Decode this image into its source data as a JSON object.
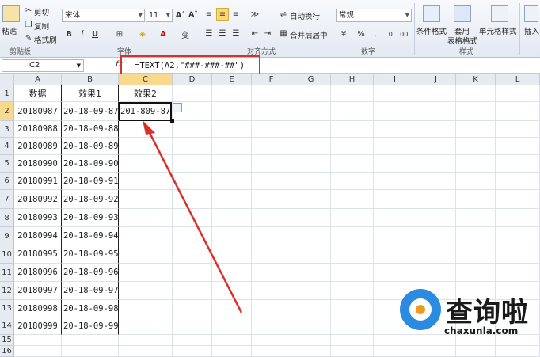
{
  "ribbon": {
    "clipboard": {
      "paste": "粘贴",
      "cut": "剪切",
      "copy": "复制",
      "format_painter": "格式刷",
      "group": "剪贴板"
    },
    "font": {
      "font_name": "宋体",
      "font_size": "11",
      "group": "字体",
      "bold": "B",
      "italic": "I",
      "underline": "U"
    },
    "alignment": {
      "wrap": "自动换行",
      "merge": "合并后居中",
      "group": "对齐方式"
    },
    "number": {
      "format": "常规",
      "percent": "%",
      "comma": ",",
      "group": "数字"
    },
    "styles": {
      "conditional": "条件格式",
      "table": "套用",
      "table2": "表格格式",
      "cell_styles": "单元格样式",
      "group": "样式"
    },
    "cells": {
      "insert": "插入"
    }
  },
  "formula_bar": {
    "name_box": "C2",
    "fx": "fx",
    "formula": "=TEXT(A2,\"###-###-##\")"
  },
  "columns": [
    "A",
    "B",
    "C",
    "D",
    "E",
    "F",
    "G",
    "H",
    "I",
    "J",
    "K",
    "L"
  ],
  "rows": [
    "1",
    "2",
    "3",
    "4",
    "5",
    "6",
    "7",
    "8",
    "9",
    "10",
    "11",
    "12",
    "13",
    "14",
    "15",
    "16"
  ],
  "headers": {
    "a": "数据",
    "b": "效果1",
    "c": "效果2"
  },
  "data": [
    {
      "a": "20180987",
      "b": "20-18-09-87",
      "c": "201-809-87"
    },
    {
      "a": "20180988",
      "b": "20-18-09-88"
    },
    {
      "a": "20180989",
      "b": "20-18-09-89"
    },
    {
      "a": "20180990",
      "b": "20-18-09-90"
    },
    {
      "a": "20180991",
      "b": "20-18-09-91"
    },
    {
      "a": "20180992",
      "b": "20-18-09-92"
    },
    {
      "a": "20180993",
      "b": "20-18-09-93"
    },
    {
      "a": "20180994",
      "b": "20-18-09-94"
    },
    {
      "a": "20180995",
      "b": "20-18-09-95"
    },
    {
      "a": "20180996",
      "b": "20-18-09-96"
    },
    {
      "a": "20180997",
      "b": "20-18-09-97"
    },
    {
      "a": "20180998",
      "b": "20-18-09-98"
    },
    {
      "a": "20180999",
      "b": "20-18-09-99"
    }
  ],
  "watermark": {
    "text": "查询啦",
    "url": "chaxunla.com"
  },
  "colors": {
    "annotation": "#d9302c",
    "selected_header": "#f8d98e"
  }
}
